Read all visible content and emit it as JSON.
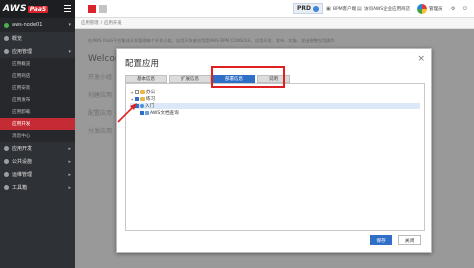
{
  "brand": {
    "aws": "AWS",
    "paas": "PaaS"
  },
  "sidebar": {
    "server": "aws-node01",
    "items": [
      {
        "label": "概览"
      },
      {
        "label": "应用管理"
      }
    ],
    "sub_items": [
      {
        "label": "应用概览"
      },
      {
        "label": "应用商店"
      },
      {
        "label": "应用安装"
      },
      {
        "label": "应用发布"
      },
      {
        "label": "应用卸载"
      },
      {
        "label": "应用开发"
      },
      {
        "label": "消息中心"
      }
    ],
    "items2": [
      {
        "label": "应用开发"
      },
      {
        "label": "公共设施"
      },
      {
        "label": "运维管理"
      },
      {
        "label": "工具箱"
      }
    ]
  },
  "topbar": {
    "env": "PRD",
    "link1": "BPM客户端",
    "link2": "访问AWS企业应用商店",
    "user": "管理员"
  },
  "breadcrumb": {
    "home": "应用管理",
    "sep": "/",
    "current": "应用开发"
  },
  "background": {
    "notice": "在AWS PaaS平台集成开发管理每个开发小组、应用开发者应用是AWS BPM CONSOLE、应用开发、发布、实施、发出修整应用操作",
    "welcome": "Welcome",
    "tabs": [
      "开发小组",
      "创建应用",
      "配置应用",
      "分发应用"
    ]
  },
  "modal": {
    "title": "配置应用",
    "tabs": [
      "基本信息",
      "扩展信息",
      "部署信息",
      "说明"
    ],
    "active_tab": 2,
    "tree": [
      {
        "label": "办公",
        "checked": false
      },
      {
        "label": "练习",
        "checked": true
      },
      {
        "label": "入门",
        "checked": true
      },
      {
        "label": "AWS文档查询",
        "checked": true
      }
    ],
    "save_label": "保存",
    "close_label": "关闭"
  },
  "colors": {
    "accent": "#2f6fc7",
    "brand_red": "#d9232d",
    "annotation": "#e02020"
  }
}
